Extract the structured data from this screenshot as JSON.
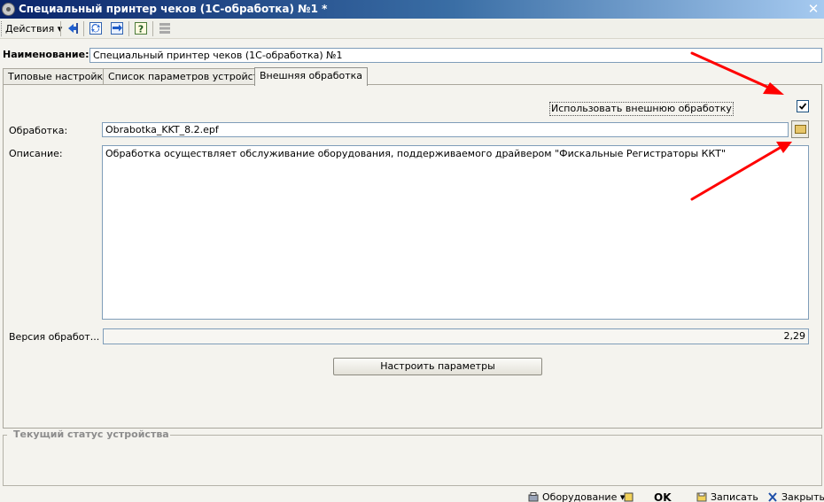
{
  "window": {
    "title": "Специальный принтер чеков (1С-обработка) №1 *",
    "close_glyph": "✕"
  },
  "toolbar": {
    "actions_label": "Действия ▾",
    "icons": [
      "back-arrow-icon",
      "refresh-icon",
      "sync-icon",
      "help-icon",
      "list-icon"
    ]
  },
  "name": {
    "label": "Наименование:",
    "value": "Специальный принтер чеков (1С-обработка) №1"
  },
  "tabs": [
    {
      "label": "Типовые настройки",
      "active": false
    },
    {
      "label": "Список параметров устройства",
      "active": false
    },
    {
      "label": "Внешняя обработка",
      "active": true
    }
  ],
  "external": {
    "use_external_label": "Использовать внешнюю обработку",
    "use_external_checked": true,
    "processing_label": "Обработка:",
    "processing_value": "Obrabotka_KKT_8.2.epf",
    "description_label": "Описание:",
    "description_value": "Обработка осуществляет обслуживание оборудования, поддерживаемого драйвером \"Фискальные Регистраторы ККТ\"",
    "version_label": "Версия обработ...",
    "version_value": "2,29",
    "setup_button_label": "Настроить параметры"
  },
  "status": {
    "group_title": "Текущий статус устройства"
  },
  "bottom": {
    "equipment_label": "Оборудование ▾",
    "ok_label": "OK",
    "save_label": "Записать",
    "close_label": "Закрыть"
  },
  "colors": {
    "titlebar_start": "#0a246a",
    "titlebar_end": "#a6caf0",
    "annotation_arrow": "#ff0000"
  }
}
